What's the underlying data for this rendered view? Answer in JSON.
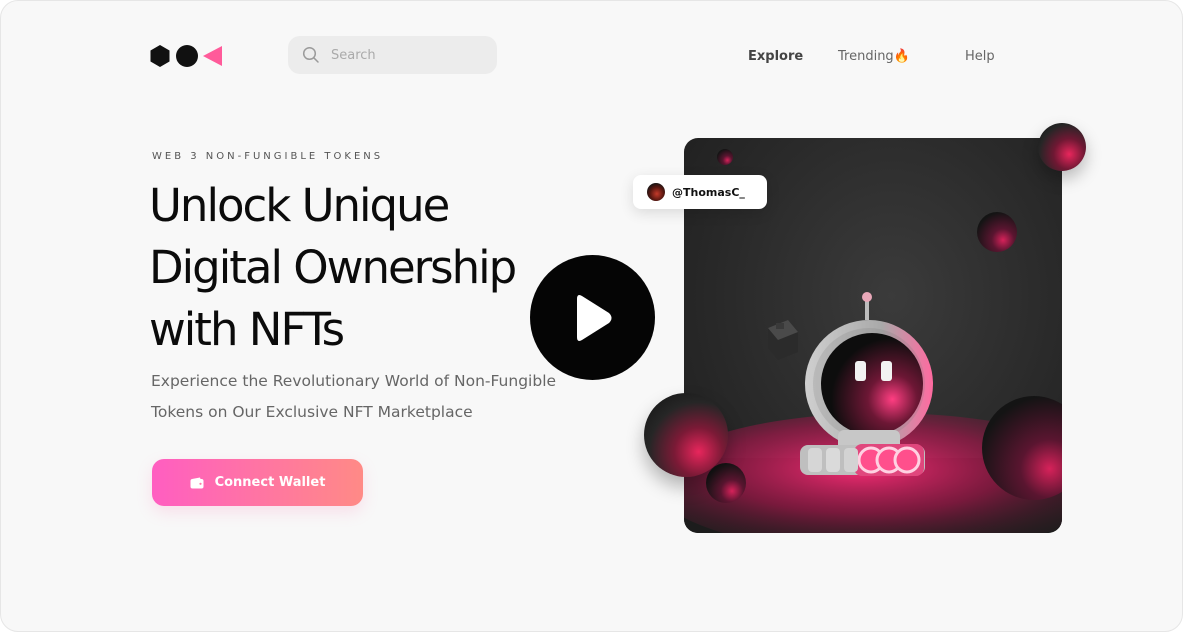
{
  "logo": {
    "shapes": [
      "hexagon",
      "circle",
      "triangle"
    ],
    "colors": {
      "dark": "#111111",
      "accent": "#ff5b9a"
    }
  },
  "search": {
    "placeholder": "Search",
    "value": ""
  },
  "nav": {
    "items": [
      {
        "label": "Explore",
        "active": true
      },
      {
        "label": "Trending🔥",
        "active": false
      },
      {
        "label": "Help",
        "active": false
      }
    ]
  },
  "hero": {
    "eyebrow": "WEB 3 NON-FUNGIBLE TOKENS",
    "headline_lines": [
      "Unlock Unique",
      "Digital Ownership",
      "with NFTs"
    ],
    "subtext_lines": [
      "Experience the Revolutionary World of Non-Fungible",
      "Tokens on Our Exclusive NFT Marketplace"
    ],
    "cta_label": "Connect Wallet"
  },
  "artwork": {
    "creator": "@ThomasC_",
    "icons": {
      "play": "play-icon",
      "wallet": "wallet-icon",
      "search": "search-icon"
    }
  },
  "colors": {
    "page_bg": "#f8f8f8",
    "cta_gradient_start": "#ff5ec1",
    "cta_gradient_end": "#ff8a86",
    "art_accent": "#e8265c"
  }
}
